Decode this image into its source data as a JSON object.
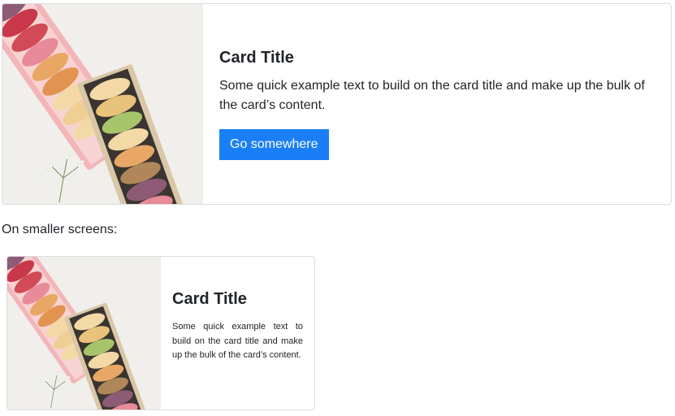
{
  "large_card": {
    "title": "Card Title",
    "text": "Some quick example text to build on the card title and make up the bulk of the card’s content.",
    "button_label": "Go somewhere"
  },
  "caption": "On smaller screens:",
  "small_card": {
    "title": "Card Title",
    "text": "Some quick example text to build on the card title and make up the bulk of the card’s content."
  },
  "image": {
    "icon": "macarons-photo",
    "colors": {
      "background": "#f1efec",
      "box_pink": "#f3b5b8",
      "box_tan": "#d9c7a8",
      "macaron_cream": "#f2d9a6",
      "macaron_orange": "#e9a765",
      "macaron_red": "#c8374a",
      "macaron_plum": "#8d5b76",
      "macaron_green": "#a8c46a",
      "macaron_pink": "#e88a9a",
      "macaron_brown": "#b0875a",
      "accent": "#1a7ff7"
    }
  }
}
